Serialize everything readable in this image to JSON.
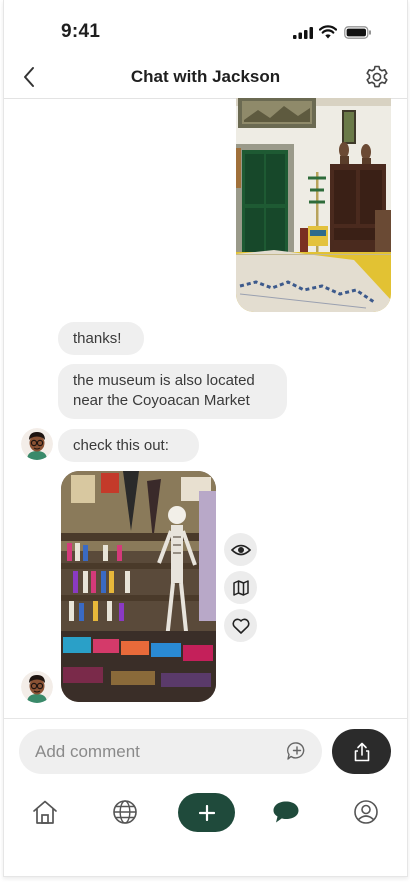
{
  "status_bar": {
    "time": "9:41",
    "icons": [
      "signal-icon",
      "wifi-icon",
      "battery-icon"
    ]
  },
  "header": {
    "title": "Chat with Jackson",
    "back_icon": "chevron-left-icon",
    "settings_icon": "gear-icon"
  },
  "messages": [
    {
      "from": "me",
      "type": "photo",
      "subject": "museum-interior"
    },
    {
      "from": "Jackson",
      "type": "text",
      "text": "thanks!"
    },
    {
      "from": "Jackson",
      "type": "text",
      "text": "the museum is also located near the Coyoacan Market"
    },
    {
      "from": "Jackson",
      "type": "text",
      "text": "check this out:"
    },
    {
      "from": "Jackson",
      "type": "photo",
      "subject": "market-stall"
    }
  ],
  "photo_actions": [
    "eye-icon",
    "map-icon",
    "heart-icon"
  ],
  "composer": {
    "placeholder": "Add comment",
    "emoji_icon": "add-reaction-icon",
    "share_icon": "share-icon"
  },
  "tab_bar": {
    "items": [
      "home-icon",
      "globe-icon",
      "plus-icon",
      "chat-icon",
      "profile-icon"
    ],
    "active": "chat-icon"
  },
  "colors": {
    "brand_green": "#1f4a3b",
    "bubble_bg": "#efefef",
    "share_btn": "#2b2b2b"
  }
}
